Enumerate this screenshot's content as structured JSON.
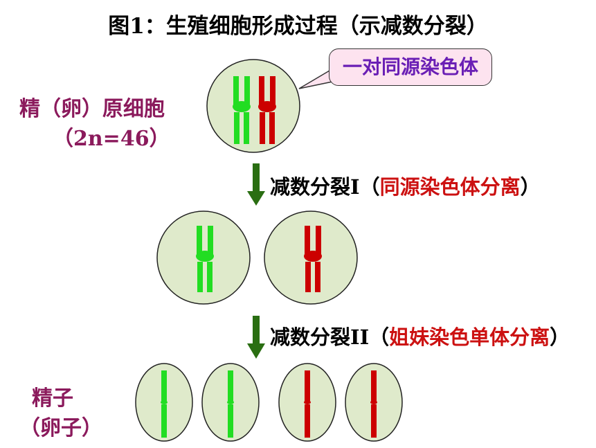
{
  "title": "图1：生殖细胞形成过程（示减数分裂）",
  "callout": "一对同源染色体",
  "parent_cell": {
    "name": "精（卵）原细胞",
    "ploidy": "（2n=46）"
  },
  "step1": {
    "name": "减数分裂I",
    "note_open": "（",
    "note": "同源染色体分离",
    "note_close": "）"
  },
  "step2": {
    "name": "减数分裂II",
    "note_open": "（",
    "note": "姐妹染色单体分离",
    "note_close": "）"
  },
  "gametes": {
    "name": "精子",
    "alt": "（卵子）"
  },
  "colors": {
    "cell_fill": "#dfeacb",
    "green_chromosome": "#22dd22",
    "red_chromosome": "#cc0000",
    "arrow": "#2a6e12",
    "callout_fill": "#fde3ef",
    "callout_text": "#6a1fb5",
    "label_purple": "#8b1a5c"
  }
}
